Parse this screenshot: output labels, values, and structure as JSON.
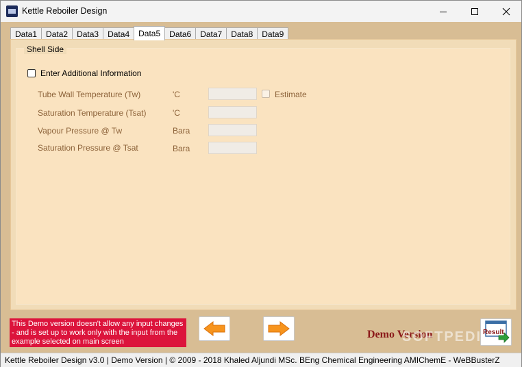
{
  "window": {
    "title": "Kettle Reboiler Design"
  },
  "tabs": [
    "Data1",
    "Data2",
    "Data3",
    "Data4",
    "Data5",
    "Data6",
    "Data7",
    "Data8",
    "Data9"
  ],
  "active_tab": "Data5",
  "group": {
    "title": "Shell Side",
    "checkbox_label": "Enter Additional Information",
    "rows": [
      {
        "label": "Tube Wall Temperature (Tw)",
        "unit": "'C",
        "value": ""
      },
      {
        "label": "Saturation Temperature (Tsat)",
        "unit": "'C",
        "value": ""
      },
      {
        "label": "Vapour Pressure @ Tw",
        "unit": "Bara",
        "value": ""
      },
      {
        "label": "Saturation Pressure @ Tsat",
        "unit": "Bara",
        "value": ""
      }
    ],
    "estimate_label": "Estimate"
  },
  "warning": "This Demo version doesn't allow any input changes - and is set up to work only with the input from the example selected on main screen",
  "demo_label": "Demo Version",
  "result_label": "Result",
  "watermark": "SOFTPEDIA",
  "status": "Kettle Reboiler Design  v3.0  |  Demo Version  |  © 2009 - 2018 Khaled Aljundi MSc. BEng Chemical Engineering AMIChemE - WeBBusterZ",
  "colors": {
    "form_bg": "#d8bd94",
    "panel_bg": "#fae3c0",
    "label": "#8c6239",
    "warning_bg": "#dc143c",
    "arrow": "#f7941d"
  }
}
